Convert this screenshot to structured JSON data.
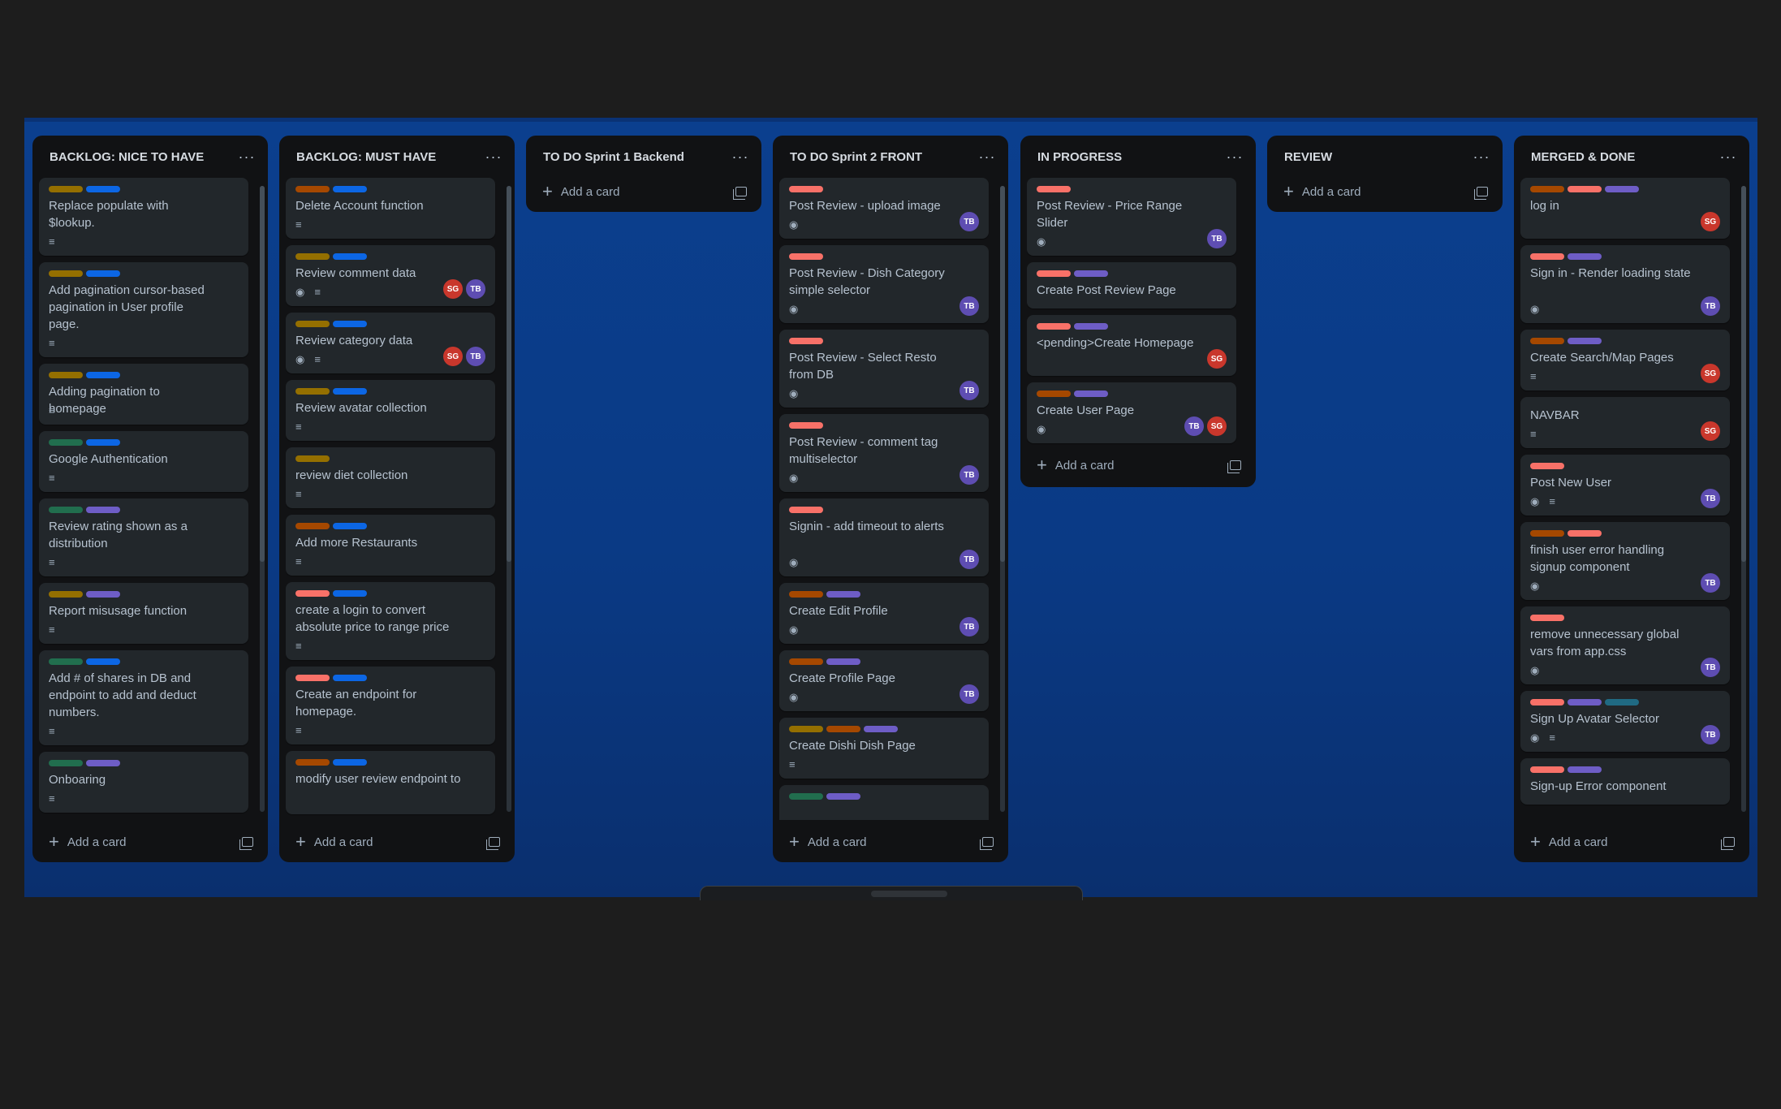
{
  "label_colors": {
    "yellow": "#946f00",
    "blue": "#0c66e4",
    "green": "#216e4e",
    "purple": "#6e5dc6",
    "red": "#f87168",
    "orange": "#a54800",
    "teal": "#206a83"
  },
  "add_card_label": "Add a card",
  "lists": [
    {
      "title": "BACKLOG: NICE TO HAVE",
      "cards": [
        {
          "title": "Replace populate with $lookup.",
          "labels": [
            "yellow",
            "blue"
          ],
          "watch": false,
          "desc": true,
          "members": []
        },
        {
          "title": "Add pagination cursor-based pagination in User profile page.",
          "labels": [
            "yellow",
            "blue"
          ],
          "watch": false,
          "desc": true,
          "members": []
        },
        {
          "title": "Adding pagination to homepage",
          "labels": [
            "yellow",
            "blue"
          ],
          "watch": false,
          "desc": true,
          "members": []
        },
        {
          "title": "Google Authentication",
          "labels": [
            "green",
            "blue"
          ],
          "watch": false,
          "desc": true,
          "members": []
        },
        {
          "title": "Review rating shown as a distribution",
          "labels": [
            "green",
            "purple"
          ],
          "watch": false,
          "desc": true,
          "members": []
        },
        {
          "title": "Report misusage function",
          "labels": [
            "yellow",
            "purple"
          ],
          "watch": false,
          "desc": true,
          "members": []
        },
        {
          "title": "Add # of shares in DB and endpoint to add and deduct numbers.",
          "labels": [
            "green",
            "blue"
          ],
          "watch": false,
          "desc": true,
          "members": []
        },
        {
          "title": "Onboaring",
          "labels": [
            "green",
            "purple"
          ],
          "watch": false,
          "desc": true,
          "members": []
        }
      ]
    },
    {
      "title": "BACKLOG: MUST HAVE",
      "cards": [
        {
          "title": "Delete Account function",
          "labels": [
            "orange",
            "blue"
          ],
          "watch": false,
          "desc": true,
          "members": []
        },
        {
          "title": "Review comment data",
          "labels": [
            "yellow",
            "blue"
          ],
          "watch": true,
          "desc": true,
          "members": [
            "SG",
            "TB"
          ]
        },
        {
          "title": "Review category data",
          "labels": [
            "yellow",
            "blue"
          ],
          "watch": true,
          "desc": true,
          "members": [
            "SG",
            "TB"
          ]
        },
        {
          "title": "Review avatar collection",
          "labels": [
            "yellow",
            "blue"
          ],
          "watch": false,
          "desc": true,
          "members": []
        },
        {
          "title": "review diet collection",
          "labels": [
            "yellow"
          ],
          "watch": false,
          "desc": true,
          "members": []
        },
        {
          "title": "Add more Restaurants",
          "labels": [
            "orange",
            "blue"
          ],
          "watch": false,
          "desc": true,
          "members": []
        },
        {
          "title": "create a login to convert absolute price to range price",
          "labels": [
            "red",
            "blue"
          ],
          "watch": false,
          "desc": true,
          "members": []
        },
        {
          "title": "Create an endpoint for homepage.",
          "labels": [
            "red",
            "blue"
          ],
          "watch": false,
          "desc": true,
          "members": []
        },
        {
          "title": "modify user review endpoint to",
          "labels": [
            "orange",
            "blue"
          ],
          "watch": false,
          "desc": false,
          "members": []
        }
      ]
    },
    {
      "title": "TO DO Sprint 1 Backend",
      "cards": []
    },
    {
      "title": "TO DO Sprint 2 FRONT",
      "cards": [
        {
          "title": "Post Review - upload image",
          "labels": [
            "red"
          ],
          "watch": true,
          "desc": false,
          "members": [
            "TB"
          ]
        },
        {
          "title": "Post Review - Dish Category simple selector",
          "labels": [
            "red"
          ],
          "watch": true,
          "desc": false,
          "members": [
            "TB"
          ]
        },
        {
          "title": "Post Review - Select Resto from DB",
          "labels": [
            "red"
          ],
          "watch": true,
          "desc": false,
          "members": [
            "TB"
          ]
        },
        {
          "title": "Post Review - comment tag multiselector",
          "labels": [
            "red"
          ],
          "watch": true,
          "desc": false,
          "members": [
            "TB"
          ]
        },
        {
          "title": "Signin - add timeout to alerts",
          "labels": [
            "red"
          ],
          "watch": true,
          "desc": false,
          "members": [
            "TB"
          ]
        },
        {
          "title": "Create Edit Profile",
          "labels": [
            "orange",
            "purple"
          ],
          "watch": true,
          "desc": false,
          "members": [
            "TB"
          ]
        },
        {
          "title": "Create Profile Page",
          "labels": [
            "orange",
            "purple"
          ],
          "watch": true,
          "desc": false,
          "members": [
            "TB"
          ]
        },
        {
          "title": "Create Dishi Dish Page",
          "labels": [
            "yellow",
            "orange",
            "purple"
          ],
          "watch": false,
          "desc": true,
          "members": []
        },
        {
          "title": "",
          "labels": [
            "green",
            "purple"
          ],
          "watch": false,
          "desc": false,
          "members": []
        }
      ]
    },
    {
      "title": "IN PROGRESS",
      "cards": [
        {
          "title": "Post Review - Price Range Slider",
          "labels": [
            "red"
          ],
          "watch": true,
          "desc": false,
          "members": [
            "TB"
          ]
        },
        {
          "title": "Create Post Review Page",
          "labels": [
            "red",
            "purple"
          ],
          "watch": false,
          "desc": false,
          "members": []
        },
        {
          "title": "<pending>Create Homepage",
          "labels": [
            "red",
            "purple"
          ],
          "watch": false,
          "desc": false,
          "members": [
            "SG"
          ]
        },
        {
          "title": "Create User Page",
          "labels": [
            "orange",
            "purple"
          ],
          "watch": true,
          "desc": false,
          "members": [
            "TB",
            "SG"
          ]
        }
      ]
    },
    {
      "title": "REVIEW",
      "cards": []
    },
    {
      "title": "MERGED & DONE",
      "cards": [
        {
          "title": "log in",
          "labels": [
            "orange",
            "red",
            "purple"
          ],
          "watch": false,
          "desc": false,
          "members": [
            "SG"
          ]
        },
        {
          "title": "Sign in - Render loading state",
          "labels": [
            "red",
            "purple"
          ],
          "watch": true,
          "desc": false,
          "members": [
            "TB"
          ]
        },
        {
          "title": "Create Search/Map Pages",
          "labels": [
            "orange",
            "purple"
          ],
          "watch": false,
          "desc": true,
          "members": [
            "SG"
          ]
        },
        {
          "title": "NAVBAR",
          "labels": [],
          "watch": false,
          "desc": true,
          "members": [
            "SG"
          ]
        },
        {
          "title": "Post New User",
          "labels": [
            "red"
          ],
          "watch": true,
          "desc": true,
          "members": [
            "TB"
          ]
        },
        {
          "title": "finish user error handling signup component",
          "labels": [
            "orange",
            "red"
          ],
          "watch": true,
          "desc": false,
          "members": [
            "TB"
          ]
        },
        {
          "title": "remove unnecessary global vars from app.css",
          "labels": [
            "red"
          ],
          "watch": true,
          "desc": false,
          "members": [
            "TB"
          ]
        },
        {
          "title": "Sign Up Avatar Selector",
          "labels": [
            "red",
            "purple",
            "teal"
          ],
          "watch": true,
          "desc": true,
          "members": [
            "TB"
          ]
        },
        {
          "title": "Sign-up Error component",
          "labels": [
            "red",
            "purple"
          ],
          "watch": false,
          "desc": false,
          "members": []
        }
      ]
    }
  ]
}
